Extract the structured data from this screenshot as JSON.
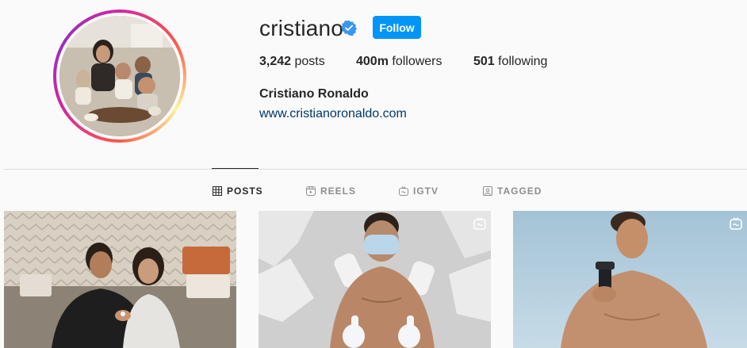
{
  "profile": {
    "username": "cristiano",
    "follow_label": "Follow",
    "full_name": "Cristiano Ronaldo",
    "website": "www.cristianoronaldo.com",
    "stats": {
      "posts_count": "3,242",
      "posts_label": "posts",
      "followers_count": "400m",
      "followers_label": "followers",
      "following_count": "501",
      "following_label": "following"
    }
  },
  "tabs": [
    {
      "label": "POSTS",
      "icon": "grid-icon",
      "active": true
    },
    {
      "label": "REELS",
      "icon": "reels-icon",
      "active": false
    },
    {
      "label": "IGTV",
      "icon": "igtv-icon",
      "active": false
    },
    {
      "label": "TAGGED",
      "icon": "tagged-icon",
      "active": false
    }
  ],
  "posts": [
    {
      "type": "photo",
      "badge": null
    },
    {
      "type": "igtv",
      "badge": "igtv-icon"
    },
    {
      "type": "igtv",
      "badge": "igtv-icon"
    }
  ],
  "colors": {
    "follow_button": "#0095f6",
    "link": "#00376b",
    "verified": "#3897f0"
  }
}
